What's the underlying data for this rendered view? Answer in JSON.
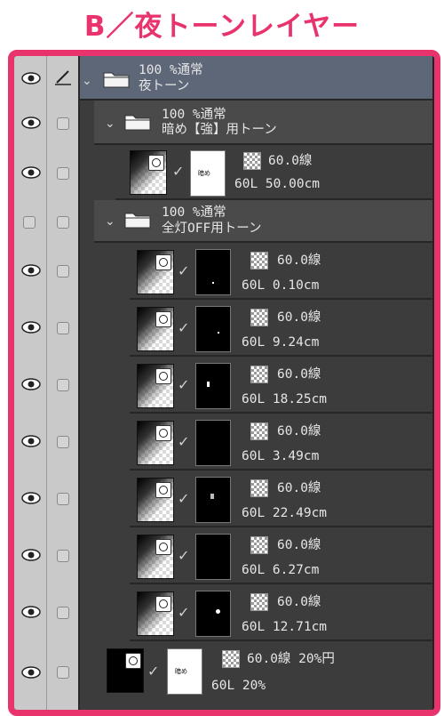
{
  "header": {
    "title": "B／夜トーンレイヤー"
  },
  "layers": [
    {
      "kind": "folder",
      "level": 0,
      "opacity_mode": "100 %通常",
      "name": "夜トーン"
    },
    {
      "kind": "folder",
      "level": 1,
      "opacity_mode": "100 %通常",
      "name": "暗め【強】用トーン"
    },
    {
      "kind": "layer",
      "screen": "60.0線",
      "info": "60L 50.00cm",
      "mask": "white"
    },
    {
      "kind": "folder",
      "level": 1,
      "opacity_mode": "100 %通常",
      "name": "全灯OFF用トーン"
    },
    {
      "kind": "layer",
      "screen": "60.0線",
      "info": "60L 0.10cm",
      "mask": "black"
    },
    {
      "kind": "layer",
      "screen": "60.0線",
      "info": "60L 9.24cm",
      "mask": "black"
    },
    {
      "kind": "layer",
      "screen": "60.0線",
      "info": "60L 18.25cm",
      "mask": "black"
    },
    {
      "kind": "layer",
      "screen": "60.0線",
      "info": "60L 3.49cm",
      "mask": "black"
    },
    {
      "kind": "layer",
      "screen": "60.0線",
      "info": "60L 22.49cm",
      "mask": "black"
    },
    {
      "kind": "layer",
      "screen": "60.0線",
      "info": "60L 6.27cm",
      "mask": "black"
    },
    {
      "kind": "layer",
      "screen": "60.0線",
      "info": "60L 12.71cm",
      "mask": "black"
    },
    {
      "kind": "layer",
      "screen": "60.0線 20%円",
      "info": "60L 20%",
      "mask": "white"
    }
  ],
  "colors": {
    "accent": "#e8336d",
    "panel": "#3c3c3c",
    "selected": "#5e6778",
    "columns": "#c9c9c9"
  },
  "icons": {
    "visibility": "eye-icon",
    "edit": "pen-icon",
    "folder": "folder-icon",
    "expand": "chevron-down-icon",
    "link": "check-icon"
  }
}
